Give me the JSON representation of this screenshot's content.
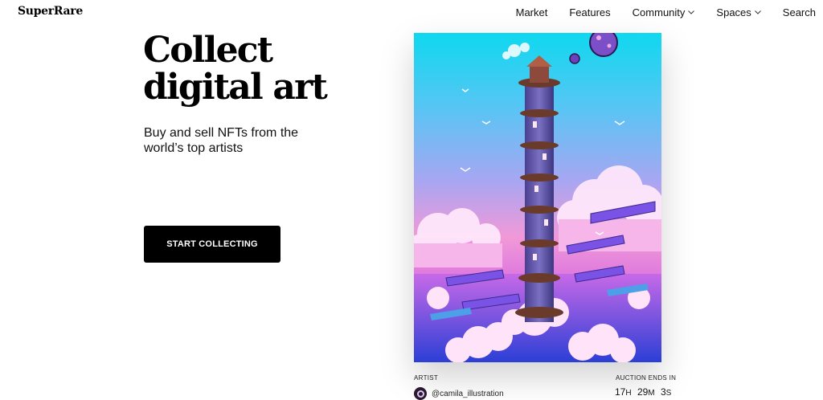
{
  "nav": {
    "logo": "SuperRare",
    "links": [
      {
        "label": "Market"
      },
      {
        "label": "Features"
      },
      {
        "label": "Community",
        "dropdown": true
      },
      {
        "label": "Spaces",
        "dropdown": true
      },
      {
        "label": "Search"
      }
    ]
  },
  "hero": {
    "title_line1": "Collect",
    "title_line2": "digital art",
    "subtitle": "Buy and sell NFTs from the world’s top artists",
    "cta_label": "START COLLECTING"
  },
  "featured": {
    "artwork_icon": "artwork-image",
    "artist_label": "ARTIST",
    "artist_handle": "@camila_illustration",
    "auction_label": "AUCTION ENDS IN",
    "countdown": {
      "hours": "17",
      "hours_unit": "H",
      "minutes": "29",
      "minutes_unit": "M",
      "seconds": "3",
      "seconds_unit": "S"
    }
  },
  "colors": {
    "cta_bg": "#000000",
    "sky_top": "#12d6ef",
    "sky_mid": "#9ab0f6",
    "sky_pink": "#f08ad2",
    "tower": "#6a5aa8"
  }
}
